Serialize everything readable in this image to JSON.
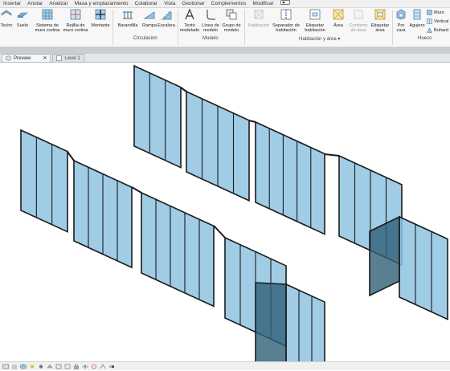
{
  "menubar": {
    "items": [
      "Insertar",
      "Anotar",
      "Analizar",
      "Masa y emplazamiento",
      "Colaborar",
      "Vista",
      "Gestionar",
      "Complementos",
      "Modificar"
    ]
  },
  "ribbon": {
    "circulacion_buttons": {
      "techo": "Techo",
      "suelo": "Suelo",
      "sistema_muro_cortina": "Sistema de muro cortina",
      "rejilla_muro_cortina": "Rejilla de muro cortina",
      "montante": "Montante",
      "barandilla": "Barandilla",
      "rampa": "Rampa",
      "escalera": "Escalera"
    },
    "modelo_buttons": {
      "texto_modelado": "Texto modelado",
      "linea_modelo": "Línea de modelo",
      "grupo_modelo": "Grupo de modelo"
    },
    "habitacion_buttons": {
      "habitacion": "Habitación",
      "separador": "Separador de habitación",
      "etiquetar_habitacion": "Etiquetar habitación",
      "area": "Área",
      "contorno_area": "Contorno de área",
      "etiquetar_area": "Etiquetar área"
    },
    "hueco_buttons": {
      "por_cara": "Por cara",
      "agujero": "Agujero",
      "muro": "Muro",
      "vertical": "Vertical",
      "buhardilla": "Buhard"
    },
    "groups": {
      "circulacion": "Circulación",
      "modelo": "Modelo",
      "habitacion_area": "Habitación y área ▾",
      "hueco": "Hueco"
    }
  },
  "tabs": [
    {
      "label": "Preview",
      "close": "✕"
    },
    {
      "label": "Level 1"
    }
  ],
  "colors": {
    "glass": "#8fc3e0",
    "glass_dark": "#2f5f78",
    "frame": "#1b1b1b",
    "accent_tab": "#e8b63a"
  },
  "icons": [
    "techo-icon",
    "suelo-icon",
    "curtain-system-icon",
    "curtain-grid-icon",
    "mullion-icon",
    "railing-icon",
    "ramp-icon",
    "stair-icon",
    "model-text-icon",
    "model-line-icon",
    "model-group-icon",
    "room-icon",
    "room-separator-icon",
    "tag-room-icon",
    "area-icon",
    "area-boundary-icon",
    "tag-area-icon",
    "by-face-icon",
    "shaft-icon",
    "wall-opening-icon",
    "vertical-opening-icon",
    "dormer-icon"
  ]
}
